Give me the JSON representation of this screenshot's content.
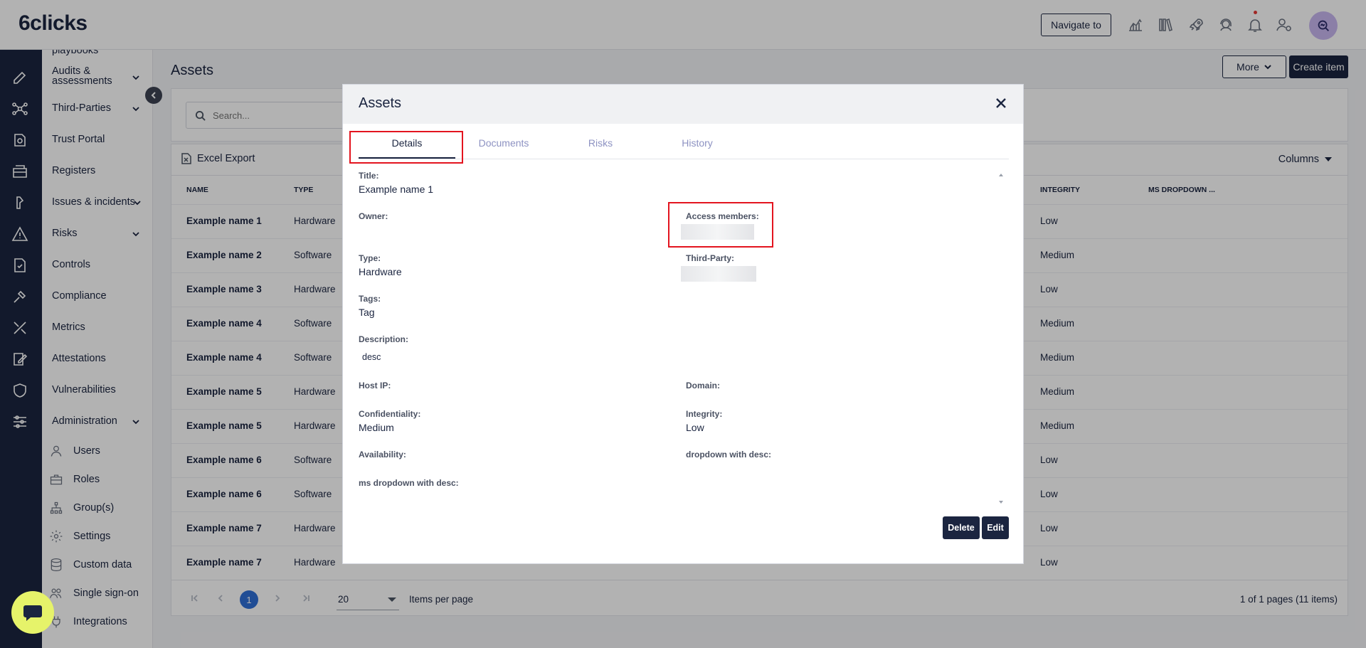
{
  "app": {
    "logo": "6clicks"
  },
  "topbar": {
    "navigate_label": "Navigate to"
  },
  "sidebar": {
    "items": [
      {
        "label": "playbooks"
      },
      {
        "label": "Audits & assessments"
      },
      {
        "label": "Third-Parties"
      },
      {
        "label": "Trust Portal"
      },
      {
        "label": "Registers"
      },
      {
        "label": "Issues & incidents"
      },
      {
        "label": "Risks"
      },
      {
        "label": "Controls"
      },
      {
        "label": "Compliance"
      },
      {
        "label": "Metrics"
      },
      {
        "label": "Attestations"
      },
      {
        "label": "Vulnerabilities"
      },
      {
        "label": "Administration"
      }
    ],
    "sub_items": [
      {
        "label": "Users"
      },
      {
        "label": "Roles"
      },
      {
        "label": "Group(s)"
      },
      {
        "label": "Settings"
      },
      {
        "label": "Custom data"
      },
      {
        "label": "Single sign-on"
      },
      {
        "label": "Integrations"
      }
    ]
  },
  "page": {
    "title": "Assets",
    "more_label": "More",
    "create_label": "Create item",
    "search_placeholder": "Search..."
  },
  "grid": {
    "excel_label": "Excel Export",
    "columns_label": "Columns",
    "headers": {
      "name": "NAME",
      "type": "TYPE",
      "integrity": "INTEGRITY",
      "ms_dropdown": "MS DROPDOWN ..."
    },
    "rows": [
      {
        "name": "Example name 1",
        "type": "Hardware",
        "integrity": "Low"
      },
      {
        "name": "Example name 2",
        "type": "Software",
        "integrity": "Medium"
      },
      {
        "name": "Example name 3",
        "type": "Hardware",
        "integrity": "Low"
      },
      {
        "name": "Example name 4",
        "type": "Software",
        "integrity": "Medium"
      },
      {
        "name": "Example name 4",
        "type": "Software",
        "integrity": "Medium"
      },
      {
        "name": "Example name 5",
        "type": "Hardware",
        "integrity": "Medium"
      },
      {
        "name": "Example name 5",
        "type": "Hardware",
        "integrity": "Medium"
      },
      {
        "name": "Example name 6",
        "type": "Software",
        "integrity": "Low"
      },
      {
        "name": "Example name 6",
        "type": "Software",
        "integrity": "Low"
      },
      {
        "name": "Example name 7",
        "type": "Hardware",
        "integrity": "Low"
      },
      {
        "name": "Example name 7",
        "type": "Hardware",
        "integrity": "Low"
      }
    ],
    "pager": {
      "current_page": "1",
      "page_size": "20",
      "items_per_page_label": "Items per page",
      "info": "1 of 1 pages (11 items)"
    }
  },
  "modal": {
    "title": "Assets",
    "tabs": [
      {
        "label": "Details"
      },
      {
        "label": "Documents"
      },
      {
        "label": "Risks"
      },
      {
        "label": "History"
      }
    ],
    "fields": {
      "title_label": "Title:",
      "title_value": "Example name 1",
      "owner_label": "Owner:",
      "access_members_label": "Access members:",
      "type_label": "Type:",
      "type_value": "Hardware",
      "third_party_label": "Third-Party:",
      "tags_label": "Tags:",
      "tags_value": "Tag",
      "description_label": "Description:",
      "description_value": "desc",
      "host_ip_label": "Host IP:",
      "domain_label": "Domain:",
      "confidentiality_label": "Confidentiality:",
      "confidentiality_value": "Medium",
      "integrity_label": "Integrity:",
      "integrity_value": "Low",
      "availability_label": "Availability:",
      "dropdown_desc_label": "dropdown with desc:",
      "ms_dropdown_desc_label": "ms dropdown with desc:"
    },
    "delete_label": "Delete",
    "edit_label": "Edit"
  },
  "colors": {
    "primary": "#1b2540",
    "highlight": "#e3141f",
    "pager_active": "#2f6fd6",
    "chat": "#e6f36a"
  }
}
